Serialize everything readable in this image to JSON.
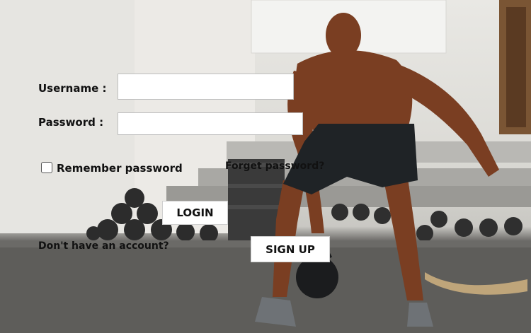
{
  "form": {
    "username_label": "Username :",
    "username_value": "",
    "password_label": "Password :",
    "password_value": "",
    "remember_label": "Remember password",
    "remember_checked": false,
    "forget_link": "Forget password?",
    "login_label": "LOGIN",
    "no_account_text": "Don't have an account?",
    "signup_label": "SIGN UP"
  },
  "background": {
    "description_icon": "gym-athlete-kettlebell-photo"
  }
}
